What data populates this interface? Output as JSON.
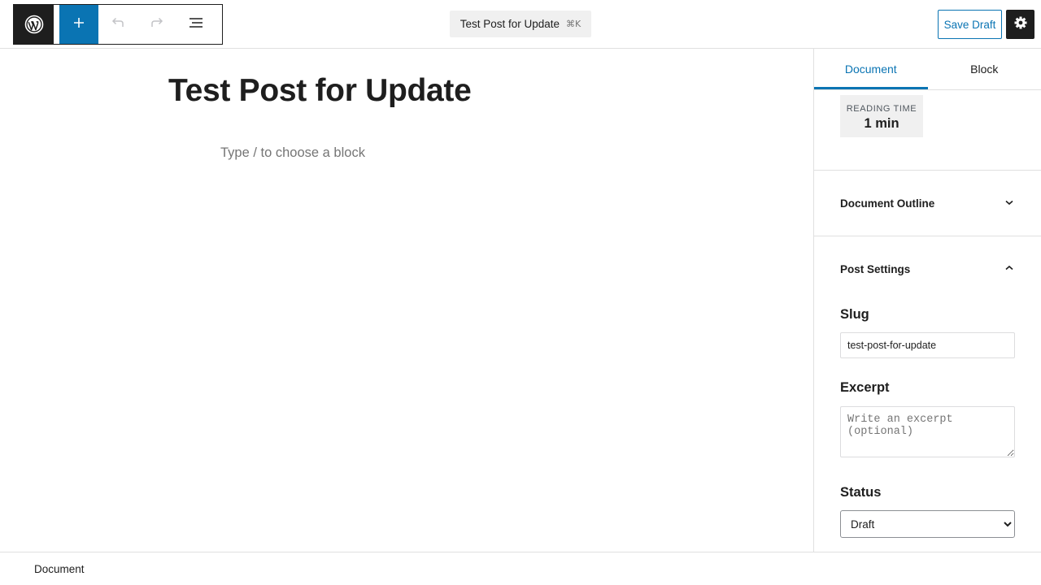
{
  "header": {
    "logo_icon": "wordpress-logo-icon",
    "inserter_icon": "plus-icon",
    "undo_icon": "undo-icon",
    "redo_icon": "redo-icon",
    "list_view_icon": "list-view-icon",
    "document_title": "Test Post for Update",
    "shortcut": "⌘K",
    "save_draft_label": "Save Draft",
    "settings_icon": "gear-icon",
    "accent_color": "#0a74b3"
  },
  "editor": {
    "post_title": "Test Post for Update",
    "block_placeholder": "Type / to choose a block"
  },
  "sidebar": {
    "tabs": [
      {
        "label": "Document",
        "active": true
      },
      {
        "label": "Block",
        "active": false
      }
    ],
    "reading_time": {
      "label": "Reading time",
      "value": "1 min"
    },
    "document_outline": {
      "title": "Document Outline",
      "icon": "chevron-down-icon"
    },
    "post_settings": {
      "title": "Post Settings",
      "icon": "chevron-up-icon",
      "slug_label": "Slug",
      "slug_value": "test-post-for-update",
      "excerpt_label": "Excerpt",
      "excerpt_placeholder": "Write an excerpt (optional)",
      "status_label": "Status",
      "status_value": "Draft"
    }
  },
  "footer": {
    "breadcrumb": "Document"
  }
}
